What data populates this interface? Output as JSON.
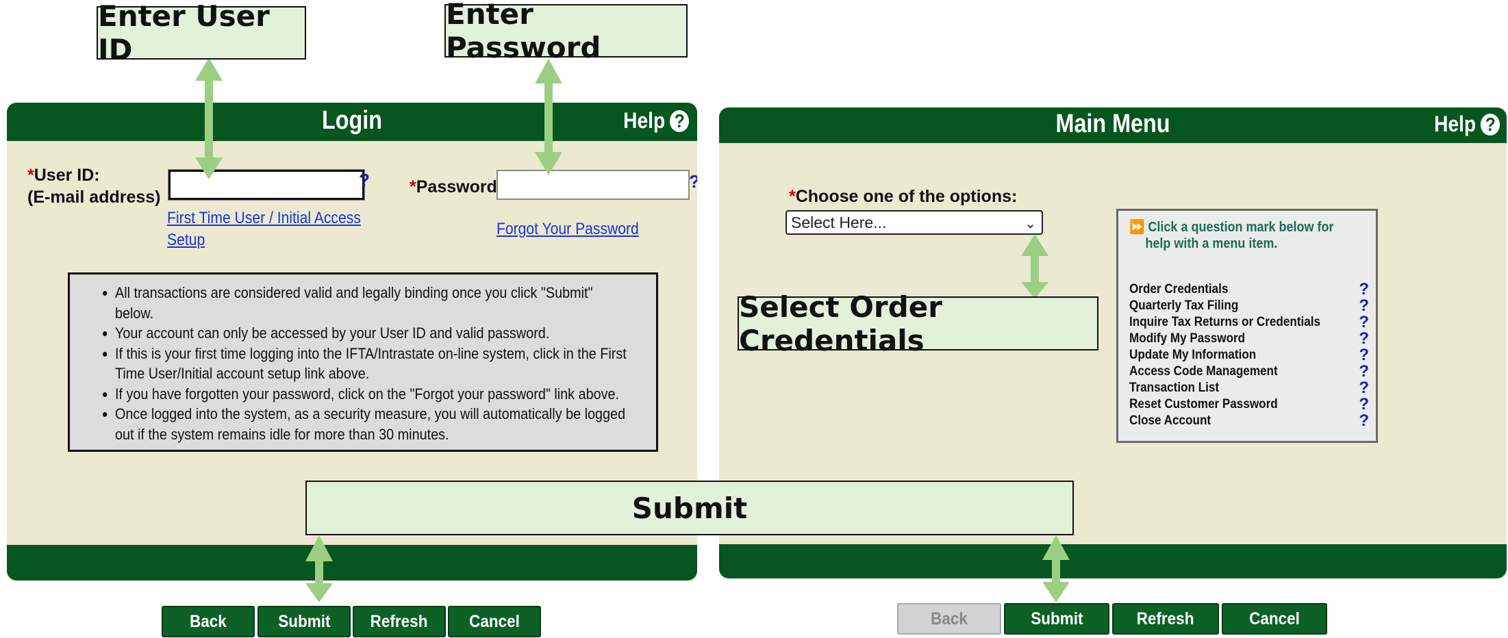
{
  "login": {
    "title": "Login",
    "help_label": "Help",
    "help_icon": "question-circle-icon",
    "userid_label_line1": "User ID:",
    "userid_label_line2": "(E-mail address)",
    "userid_value": "",
    "password_label": "Password:",
    "password_value": "",
    "required_mark": "*",
    "field_help_mark": "?",
    "first_time_link_line1": "First Time User / Initial Access",
    "first_time_link_line2": "Setup",
    "forgot_link": "Forgot Your Password",
    "notices": [
      "All transactions are considered valid and legally binding once you click \"Submit\" below.",
      "Your account can only be accessed by your User ID and valid password.",
      "If this is your first time logging into the IFTA/Intrastate on-line system, click in the First Time User/Initial account setup link above.",
      "If you have forgotten your password, click on the \"Forgot your password\" link above.",
      "Once logged into the system, as a security measure, you will automatically be logged out if the system remains idle for more than 30 minutes."
    ],
    "buttons": {
      "back": "Back",
      "submit": "Submit",
      "refresh": "Refresh",
      "cancel": "Cancel"
    }
  },
  "main_menu": {
    "title": "Main Menu",
    "help_label": "Help",
    "choose_label": "Choose one of the options:",
    "required_mark": "*",
    "select_value": "Select Here...",
    "help_box_text_line1": "Click a question mark below for",
    "help_box_text_line2": "help with a menu item.",
    "menu_items": [
      "Order Credentials",
      "Quarterly Tax Filing",
      "Inquire Tax Returns or Credentials",
      "Modify My Password",
      "Update My Information",
      "Access Code Management",
      "Transaction List",
      "Reset Customer Password",
      "Close Account"
    ],
    "item_help_mark": "?",
    "buttons": {
      "back": "Back",
      "submit": "Submit",
      "refresh": "Refresh",
      "cancel": "Cancel"
    },
    "back_disabled": true
  },
  "callouts": {
    "enter_user_id": "Enter User ID",
    "enter_password": "Enter Password",
    "select_order": "Select Order Credentials",
    "submit": "Submit"
  },
  "colors": {
    "header_green": "#07561f",
    "panel_beige": "#ebe9d0",
    "callout_fill": "#e3f0da",
    "arrow_green": "#9ccf84",
    "link_blue": "#1b33d8"
  }
}
